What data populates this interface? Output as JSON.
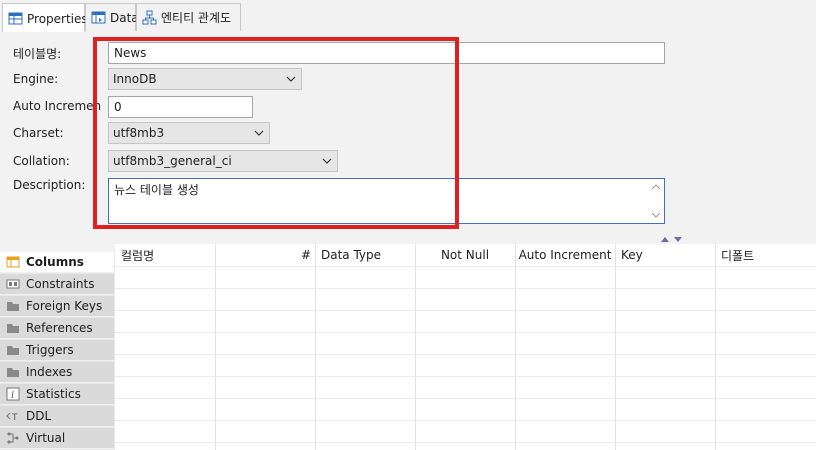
{
  "tabs": [
    {
      "label": "Properties"
    },
    {
      "label": "Data"
    },
    {
      "label": "엔티티 관계도"
    }
  ],
  "form": {
    "table_name_label": "테이블명:",
    "table_name_value": "News",
    "engine_label": "Engine:",
    "engine_value": "InnoDB",
    "auto_increment_label": "Auto Increment:",
    "auto_increment_value": "0",
    "charset_label": "Charset:",
    "charset_value": "utf8mb3",
    "collation_label": "Collation:",
    "collation_value": "utf8mb3_general_ci",
    "description_label": "Description:",
    "description_value": "뉴스 테이블 생성"
  },
  "nav": [
    {
      "label": "Columns",
      "icon": "columns-icon",
      "active": true
    },
    {
      "label": "Constraints",
      "icon": "constraints-icon"
    },
    {
      "label": "Foreign Keys",
      "icon": "folder-icon"
    },
    {
      "label": "References",
      "icon": "folder-icon"
    },
    {
      "label": "Triggers",
      "icon": "folder-icon"
    },
    {
      "label": "Indexes",
      "icon": "folder-icon"
    },
    {
      "label": "Statistics",
      "icon": "info-icon"
    },
    {
      "label": "DDL",
      "icon": "ddl-icon"
    },
    {
      "label": "Virtual",
      "icon": "virtual-icon"
    }
  ],
  "grid": {
    "columns": [
      "컬럼명",
      "#",
      "Data Type",
      "Not Null",
      "Auto Increment",
      "Key",
      "디폴트"
    ]
  },
  "colors": {
    "highlight": "#e02020",
    "accent": "#3f6fbf",
    "folder": "#8a8a8a",
    "columns_icon": "#e8a020"
  }
}
